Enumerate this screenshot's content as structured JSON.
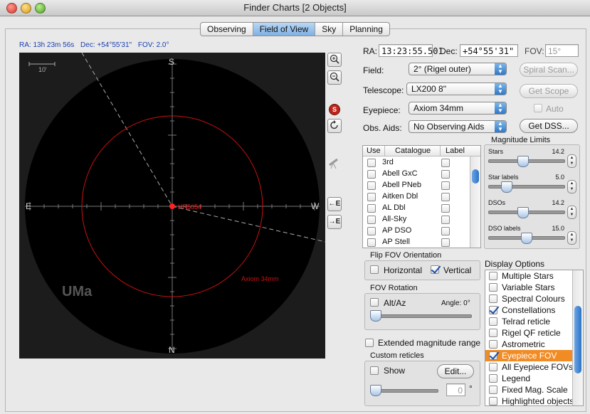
{
  "window": {
    "title": "Finder Charts [2 Objects]"
  },
  "tabs": [
    "Observing",
    "Field of View",
    "Sky",
    "Planning"
  ],
  "active_tab": "Field of View",
  "status": {
    "ra": "RA: 13h 23m 56s",
    "dec": "Dec: +54°55'31\"",
    "fov": "FOV: 2.0°"
  },
  "chart": {
    "scale_label": "10'",
    "north": "N",
    "south": "S",
    "east": "E",
    "west": "W",
    "object_label": "HR5054",
    "eyepiece_label": "Axiom 34mm",
    "constellation": "UMa",
    "colors": {
      "background": "#1c1c1c",
      "circle": "#000000",
      "reticle": "#cc1111",
      "object": "#ff2222"
    }
  },
  "side_tools": {
    "zoom_in": "zoom-in-icon",
    "zoom_out": "zoom-out-icon",
    "rigel": "S",
    "rotate": "rotate-icon",
    "telescope": "telescope-icon",
    "east_left": "←E",
    "east_right": "→E"
  },
  "coords": {
    "ra_label": "RA:",
    "ra_value": "13:23:55.501",
    "dec_label": "Dec:",
    "dec_value": "+54°55'31\"",
    "fov_label": "FOV:",
    "fov_value": "15°"
  },
  "field": {
    "label": "Field:",
    "value": "2° (Rigel outer)"
  },
  "telescope": {
    "label": "Telescope:",
    "value": "LX200 8\""
  },
  "eyepiece": {
    "label": "Eyepiece:",
    "value": "Axiom 34mm"
  },
  "obs_aids": {
    "label": "Obs. Aids:",
    "value": "No Observing Aids"
  },
  "buttons": {
    "spiral_scan": "Spiral Scan...",
    "get_scope": "Get Scope",
    "auto": "Auto",
    "get_dss": "Get DSS..."
  },
  "catalogue": {
    "headers": {
      "use": "Use",
      "catalogue": "Catalogue",
      "label": "Label"
    },
    "rows": [
      "3rd",
      "Abell GxC",
      "Abell PNeb",
      "Aitken Dbl",
      "AL Dbl",
      "All-Sky",
      "AP DSO",
      "AP Stell"
    ]
  },
  "magnitude_limits": {
    "title": "Magnitude Limits",
    "sliders": [
      {
        "label": "Stars",
        "value": "14.2",
        "fraction": 0.45
      },
      {
        "label": "Star labels",
        "value": "5.0",
        "fraction": 0.2
      },
      {
        "label": "DSOs",
        "value": "14.2",
        "fraction": 0.45
      },
      {
        "label": "DSO labels",
        "value": "15.0",
        "fraction": 0.5
      }
    ]
  },
  "flip": {
    "title": "Flip FOV Orientation",
    "horizontal": "Horizontal",
    "vertical": "Vertical"
  },
  "rotation": {
    "title": "FOV Rotation",
    "altaz": "Alt/Az",
    "angle_label": "Angle: 0°"
  },
  "extended": "Extended magnitude range",
  "custom": {
    "title": "Custom reticles",
    "show": "Show",
    "edit": "Edit...",
    "value": "0",
    "unit": "°"
  },
  "display_options": {
    "title": "Display Options",
    "items": [
      {
        "label": "Multiple Stars",
        "checked": false
      },
      {
        "label": "Variable Stars",
        "checked": false
      },
      {
        "label": "Spectral Colours",
        "checked": false
      },
      {
        "label": "Constellations",
        "checked": true
      },
      {
        "label": "Telrad reticle",
        "checked": false
      },
      {
        "label": "Rigel QF reticle",
        "checked": false
      },
      {
        "label": "Astrometric",
        "checked": false
      },
      {
        "label": "Eyepiece FOV",
        "checked": true,
        "selected": true
      },
      {
        "label": "All Eyepiece FOVs",
        "checked": false
      },
      {
        "label": "Legend",
        "checked": false
      },
      {
        "label": "Fixed Mag. Scale",
        "checked": false
      },
      {
        "label": "Highlighted objects",
        "checked": false
      }
    ]
  }
}
